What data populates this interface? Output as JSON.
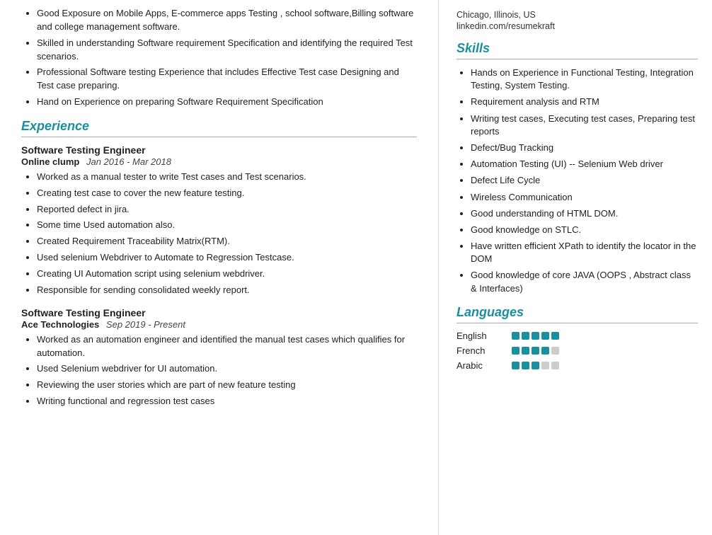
{
  "left": {
    "summary_bullets": [
      "Good Exposure on Mobile Apps, E-commerce apps Testing , school software,Billing software and college management software.",
      "Skilled in understanding Software requirement Specification and identifying the required Test scenarios.",
      "Professional Software testing Experience that includes Effective Test case Designing and Test case preparing.",
      "Hand on Experience on preparing Software Requirement Specification"
    ],
    "experience_section_title": "Experience",
    "experiences": [
      {
        "title": "Software Testing Engineer",
        "company": "Online clump",
        "dates": "Jan 2016 - Mar 2018",
        "bullets": [
          "Worked as a manual tester to write Test cases and Test scenarios.",
          "Creating test case to cover the new feature testing.",
          "Reported defect in jira.",
          "Some time Used automation also.",
          "Created Requirement Traceability Matrix(RTM).",
          "Used selenium Webdriver to Automate to Regression Testcase.",
          "Creating UI Automation script using selenium  webdriver.",
          "Responsible for sending consolidated weekly report."
        ]
      },
      {
        "title": "Software Testing Engineer",
        "company": "Ace Technologies",
        "dates": "Sep 2019 - Present",
        "bullets": [
          "Worked as an automation engineer and identified the manual test cases which qualifies for automation.",
          "Used Selenium webdriver for UI automation.",
          "Reviewing the user stories which are part of new feature testing",
          "Writing functional and regression test cases"
        ]
      }
    ]
  },
  "right": {
    "contact": [
      "Chicago, Illinois, US",
      "linkedin.com/resumekraft"
    ],
    "skills_section_title": "Skills",
    "skills": [
      "Hands on Experience in Functional Testing, Integration Testing, System Testing.",
      "Requirement analysis and RTM",
      "Writing test cases, Executing test cases, Preparing test reports",
      "Defect/Bug Tracking",
      "Automation Testing (UI) -- Selenium Web driver",
      "Defect Life Cycle",
      "Wireless Communication",
      "Good understanding of HTML DOM.",
      "Good knowledge on STLC.",
      "Have written efficient XPath to identify the locator in the DOM",
      "Good knowledge of core JAVA (OOPS , Abstract class & Interfaces)"
    ],
    "languages_section_title": "Languages",
    "languages": [
      {
        "name": "English",
        "filled": 5,
        "empty": 0
      },
      {
        "name": "French",
        "filled": 4,
        "empty": 1
      },
      {
        "name": "Arabic",
        "filled": 3,
        "empty": 2
      }
    ]
  }
}
